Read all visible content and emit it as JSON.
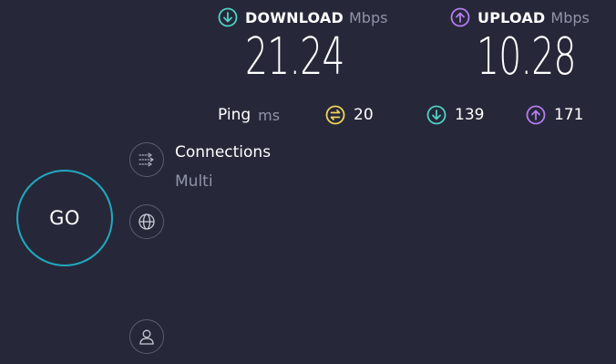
{
  "download": {
    "label": "DOWNLOAD",
    "unit": "Mbps",
    "value": "21.24",
    "icon": "download-arrow-icon",
    "color": "#4fd1c5"
  },
  "upload": {
    "label": "UPLOAD",
    "unit": "Mbps",
    "value": "10.28",
    "icon": "upload-arrow-icon",
    "color": "#b57cf0"
  },
  "ping": {
    "label": "Ping",
    "unit": "ms",
    "idle": {
      "value": "20",
      "icon": "ping-idle-icon",
      "color": "#f2d45c"
    },
    "download": {
      "value": "139",
      "icon": "download-arrow-icon",
      "color": "#4fd1c5"
    },
    "upload": {
      "value": "171",
      "icon": "upload-arrow-icon",
      "color": "#b57cf0"
    }
  },
  "go_button": {
    "label": "GO",
    "ring_color": "#1fa9c0"
  },
  "connections": {
    "title": "Connections",
    "value": "Multi",
    "icon": "connections-icon"
  },
  "side_buttons": [
    {
      "icon": "connections-icon"
    },
    {
      "icon": "globe-icon"
    },
    {
      "icon": "user-icon"
    }
  ],
  "colors": {
    "background": "#262839",
    "muted_text": "#9193a8"
  }
}
